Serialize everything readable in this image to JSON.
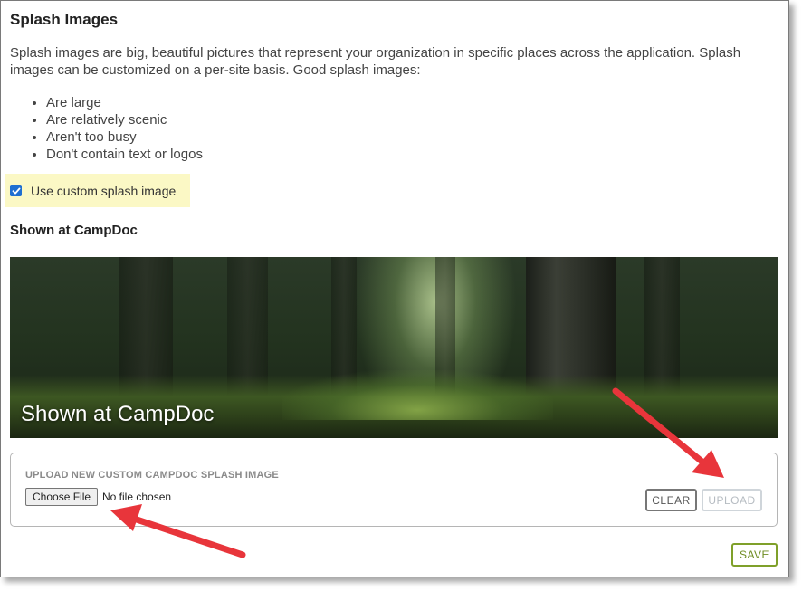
{
  "page": {
    "title": "Splash Images",
    "intro": "Splash images are big, beautiful pictures that represent your organization in specific places across the application. Splash images can be customized on a per-site basis. Good splash images:",
    "criteria": [
      "Are large",
      "Are relatively scenic",
      "Aren't too busy",
      "Don't contain text or logos"
    ]
  },
  "custom_splash": {
    "label": "Use custom splash image",
    "checked": true
  },
  "section": {
    "heading": "Shown at CampDoc",
    "preview_caption": "Shown at CampDoc"
  },
  "upload": {
    "label": "UPLOAD NEW CUSTOM CAMPDOC SPLASH IMAGE",
    "choose_file_label": "Choose File",
    "no_file_text": "No file chosen",
    "clear_label": "CLEAR",
    "upload_label": "UPLOAD"
  },
  "footer": {
    "save_label": "SAVE"
  },
  "colors": {
    "checkbox": "#1f6fd1",
    "highlight": "#fbf8c5",
    "save": "#7fa02a",
    "annotation_arrow": "#e8353b"
  }
}
